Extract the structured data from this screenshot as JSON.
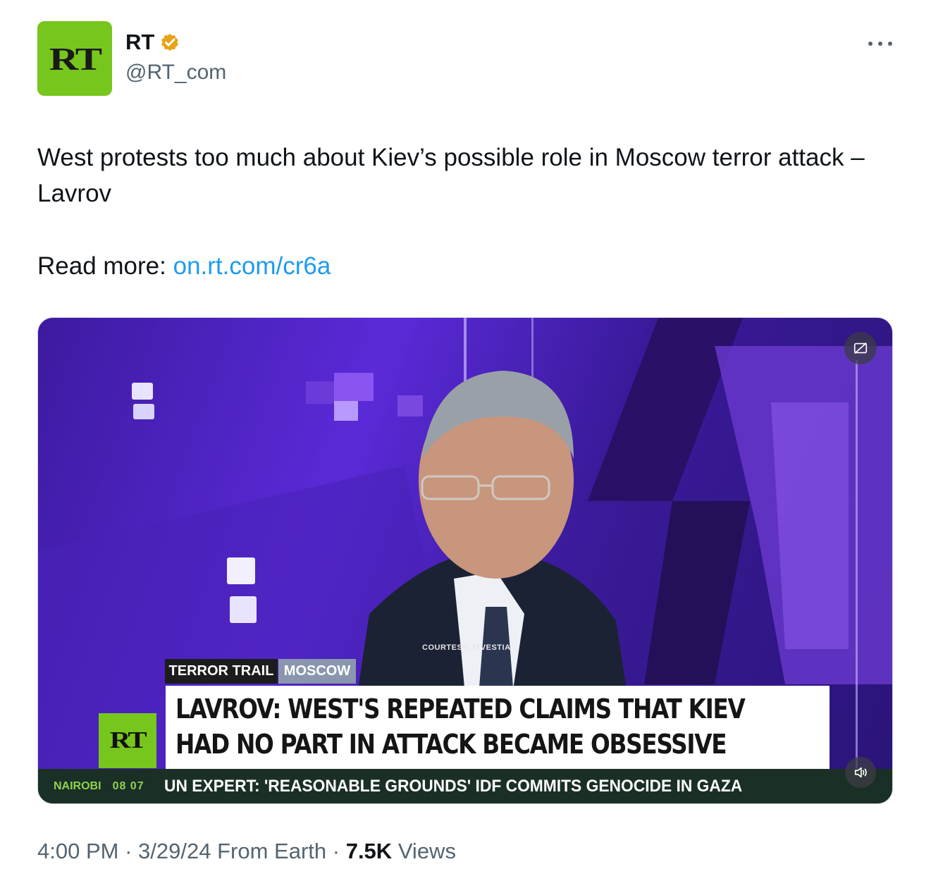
{
  "account": {
    "avatar_text": "RT",
    "name": "RT",
    "handle": "@RT_com",
    "verified_color": "#f4b400",
    "brand_color": "#77c61d"
  },
  "tweet": {
    "text": "West protests too much about Kiev’s possible role in Moscow terror attack – Lavrov",
    "read_more_label": "Read more:",
    "link": "on.rt.com/cr6a"
  },
  "media": {
    "courtesy": "COURTESY: IZVESTIA",
    "tag_primary": "TERROR TRAIL",
    "tag_secondary": "MOSCOW",
    "logo_text": "RT",
    "headline_line1": "LAVROV: WEST'S REPEATED CLAIMS THAT KIEV",
    "headline_line2": "HAD NO PART IN ATTACK BECAME OBSESSIVE",
    "ticker_city": "NAIROBI",
    "ticker_time": "08 07",
    "ticker_news": "UN EXPERT: 'REASONABLE GROUNDS' IDF COMMITS GENOCIDE IN GAZA",
    "captions_icon": "captions-off-icon",
    "volume_icon": "volume-muted-icon"
  },
  "meta": {
    "time": "4:00 PM",
    "date": "3/29/24",
    "source": "From Earth",
    "views_count": "7.5K",
    "views_label": "Views"
  }
}
